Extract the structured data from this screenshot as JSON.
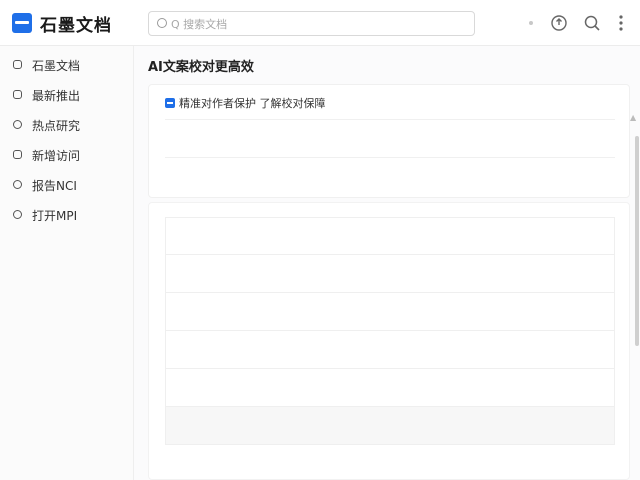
{
  "app": {
    "title": "石墨文档",
    "brand_color": "#1f6fe8"
  },
  "search": {
    "placeholder": "Q 搜索文档",
    "value": ""
  },
  "toolbar": {
    "icons": [
      "status-dot-icon",
      "share-icon",
      "search-icon",
      "more-icon"
    ]
  },
  "sidebar": {
    "items": [
      {
        "label": "石墨文档"
      },
      {
        "label": "最新推出"
      },
      {
        "label": "热点研究"
      },
      {
        "label": "新增访问"
      },
      {
        "label": "报告NCI"
      },
      {
        "label": "打开MPI"
      }
    ]
  },
  "main": {
    "heading": "AI文案校对更高效",
    "checkbox": {
      "label": "精准对作者保护 了解校对保障",
      "checked": true
    }
  }
}
